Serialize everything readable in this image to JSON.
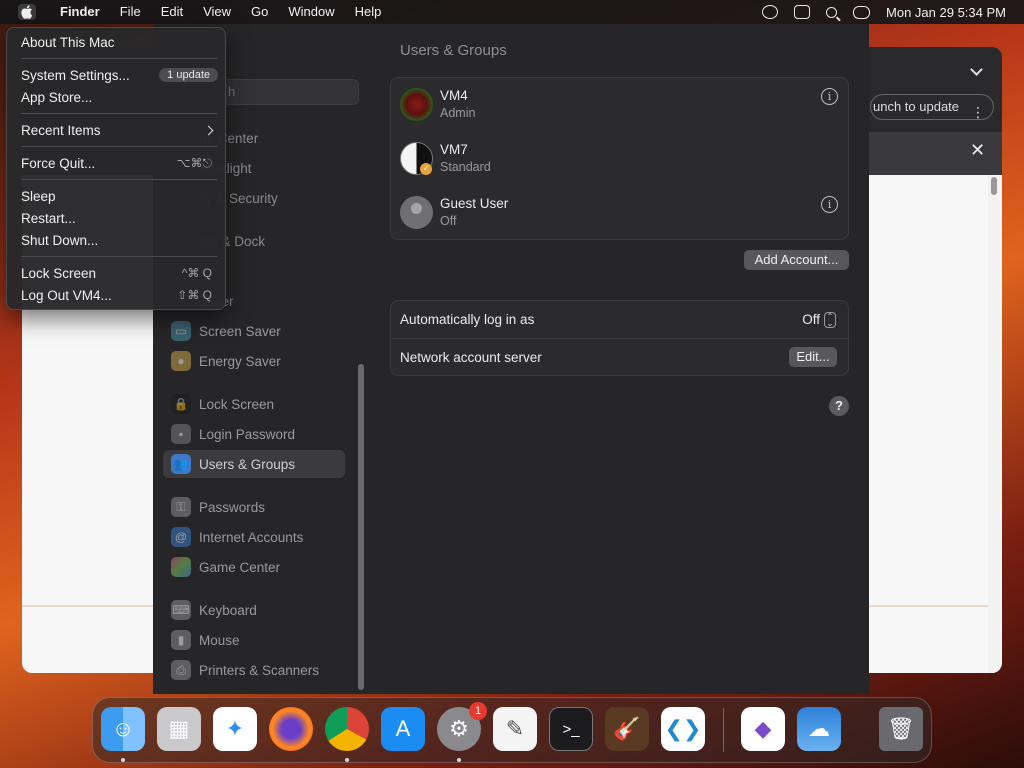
{
  "menubar": {
    "items": [
      "Finder",
      "File",
      "Edit",
      "View",
      "Go",
      "Window",
      "Help"
    ],
    "clock": "Mon Jan 29  5:34 PM"
  },
  "apple_menu": {
    "about": "About This Mac",
    "system_settings": "System Settings...",
    "update_badge": "1 update",
    "app_store": "App Store...",
    "recent_items": "Recent Items",
    "force_quit": "Force Quit...",
    "force_quit_shortcut": "⌥⌘⎋",
    "sleep": "Sleep",
    "restart": "Restart...",
    "shut_down": "Shut Down...",
    "lock_screen": "Lock Screen",
    "lock_screen_shortcut": "^⌘ Q",
    "log_out": "Log Out VM4...",
    "log_out_shortcut": "⇧⌘ Q"
  },
  "sidebar": {
    "search_placeholder": "h",
    "items": [
      {
        "label": "rol Center",
        "icon": "control-center-icon"
      },
      {
        "label": "Spotlight",
        "icon": "spotlight-icon"
      },
      {
        "label": "cy & Security",
        "icon": "privacy-security-icon"
      },
      {
        "label": "top & Dock",
        "icon": "desktop-dock-icon"
      },
      {
        "label": "ays",
        "icon": "displays-icon"
      },
      {
        "label": "paper",
        "icon": "wallpaper-icon"
      },
      {
        "label": "Screen Saver",
        "icon": "screen-saver-icon"
      },
      {
        "label": "Energy Saver",
        "icon": "energy-saver-icon"
      },
      {
        "label": "Lock Screen",
        "icon": "lock-screen-icon"
      },
      {
        "label": "Login Password",
        "icon": "login-password-icon"
      },
      {
        "label": "Users & Groups",
        "icon": "users-groups-icon"
      },
      {
        "label": "Passwords",
        "icon": "passwords-icon"
      },
      {
        "label": "Internet Accounts",
        "icon": "internet-accounts-icon"
      },
      {
        "label": "Game Center",
        "icon": "game-center-icon"
      },
      {
        "label": "Keyboard",
        "icon": "keyboard-icon"
      },
      {
        "label": "Mouse",
        "icon": "mouse-icon"
      },
      {
        "label": "Printers & Scanners",
        "icon": "printers-scanners-icon"
      }
    ],
    "selected": "Users & Groups"
  },
  "main": {
    "title": "Users & Groups",
    "users": [
      {
        "name": "VM4",
        "role": "Admin"
      },
      {
        "name": "VM7",
        "role": "Standard"
      },
      {
        "name": "Guest User",
        "role": "Off"
      }
    ],
    "add_account": "Add Account...",
    "auto_login_label": "Automatically log in as",
    "auto_login_value": "Off",
    "network_server_label": "Network account server",
    "edit_button": "Edit...",
    "help": "?"
  },
  "browser": {
    "update_text": "unch to update"
  },
  "dock": {
    "apps": [
      "Finder",
      "Launchpad",
      "Safari",
      "Firefox",
      "Chrome",
      "App Store",
      "System Settings",
      "TextEdit",
      "Terminal",
      "GarageBand",
      "Visual Studio Code",
      "Visual Studio",
      "Weather",
      "Trash"
    ],
    "settings_badge": "1"
  }
}
